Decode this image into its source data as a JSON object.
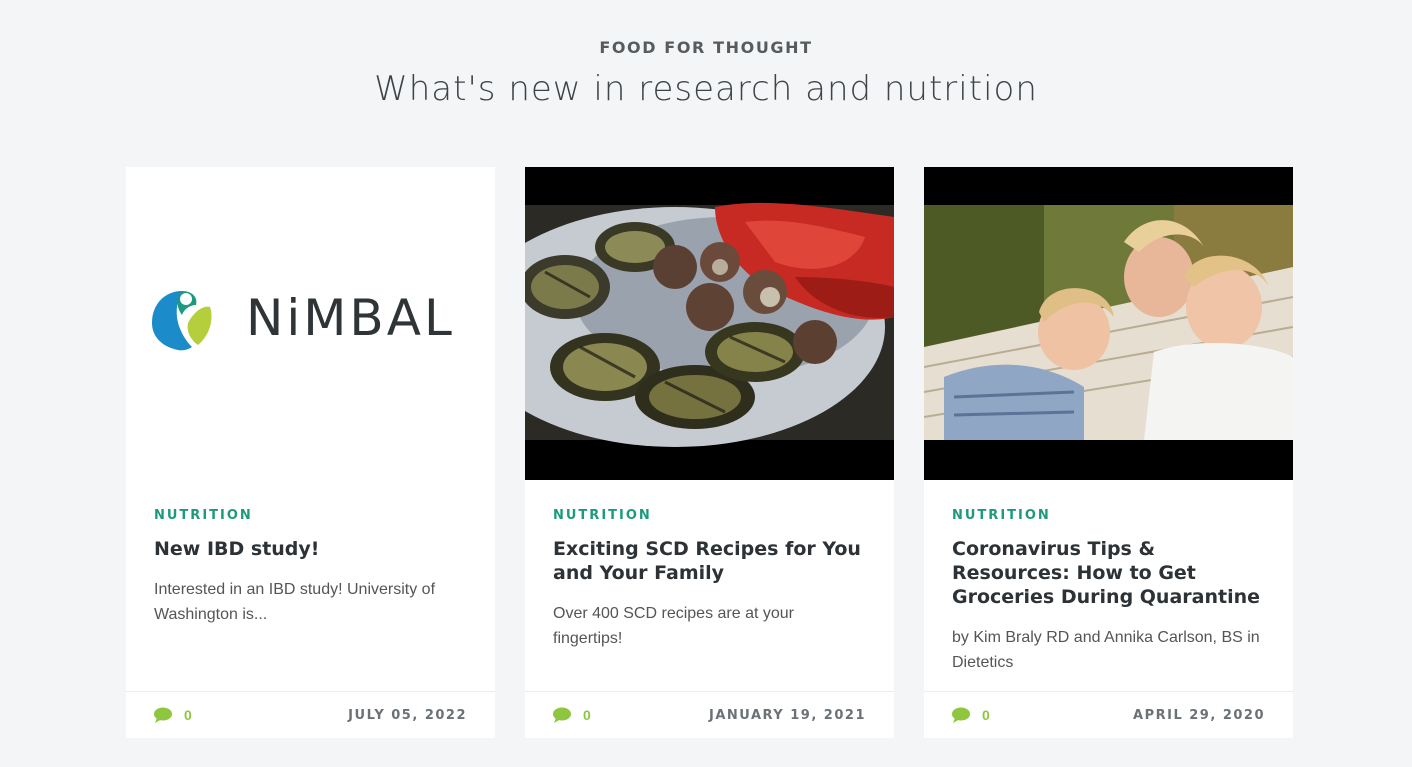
{
  "header": {
    "eyebrow": "FOOD FOR THOUGHT",
    "headline": "What's new in research and nutrition"
  },
  "cards": [
    {
      "image": "nimbal-logo",
      "logo_text": "NiMBAL",
      "category": "NUTRITION",
      "title": "New IBD study!",
      "excerpt": "Interested in an IBD study! University of Washington is...",
      "comments": "0",
      "date": "JULY 05, 2022"
    },
    {
      "image": "grilled-vegetables-photo",
      "category": "NUTRITION",
      "title": "Exciting SCD Recipes for You and Your Family",
      "excerpt": "Over 400 SCD recipes are at your fingertips!",
      "comments": "0",
      "date": "JANUARY 19, 2021"
    },
    {
      "image": "family-hammock-photo",
      "category": "NUTRITION",
      "title": "Coronavirus Tips & Resources: How to Get Groceries During Quarantine",
      "excerpt": "by Kim Braly RD and Annika Carlson, BS in Dietetics",
      "comments": "0",
      "date": "APRIL 29, 2020"
    }
  ],
  "colors": {
    "accent": "#1c9a7d",
    "comment_icon": "#8ec63f",
    "background": "#f4f5f7"
  }
}
